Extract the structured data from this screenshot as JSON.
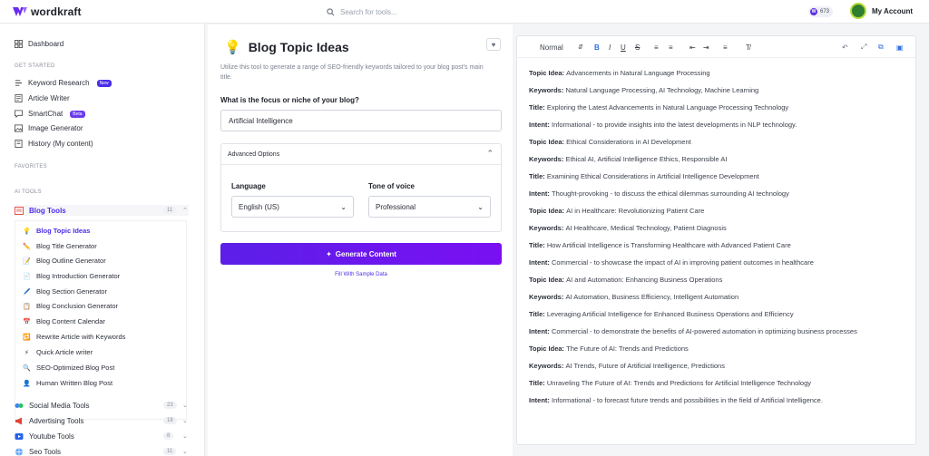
{
  "app": {
    "name": "wordkraft"
  },
  "topbar": {
    "search_placeholder": "Search for tools...",
    "credits": "673",
    "credits_icon_letter": "W",
    "account_label": "My Account"
  },
  "sidebar": {
    "dashboard": "Dashboard",
    "get_started_label": "GET STARTED",
    "get_started": [
      {
        "label": "Keyword Research",
        "badge": "New",
        "icon": "key-icon"
      },
      {
        "label": "Article Writer",
        "icon": "article-icon"
      },
      {
        "label": "SmartChat",
        "badge": "Beta",
        "icon": "chat-icon"
      },
      {
        "label": "Image Generator",
        "icon": "image-icon"
      },
      {
        "label": "History (My content)",
        "icon": "history-icon"
      }
    ],
    "favorites_label": "FAVORITES",
    "ai_tools_label": "AI TOOLS",
    "groups": [
      {
        "label": "Blog Tools",
        "count": "11",
        "chevron": "^"
      },
      {
        "label": "Social Media Tools",
        "count": "23",
        "chevron": "v"
      },
      {
        "label": "Advertising Tools",
        "count": "18",
        "chevron": "v"
      },
      {
        "label": "Youtube Tools",
        "count": "8",
        "chevron": "v"
      },
      {
        "label": "Seo Tools",
        "count": "11",
        "chevron": "v"
      }
    ],
    "blog_tools": [
      {
        "label": "Blog Topic Ideas",
        "icon": "💡"
      },
      {
        "label": "Blog Title Generator",
        "icon": "✏️"
      },
      {
        "label": "Blog Outline Generator",
        "icon": "📝"
      },
      {
        "label": "Blog Introduction Generator",
        "icon": "📄"
      },
      {
        "label": "Blog Section Generator",
        "icon": "🖊️"
      },
      {
        "label": "Blog Conclusion Generator",
        "icon": "📋"
      },
      {
        "label": "Blog Content Calendar",
        "icon": "📅"
      },
      {
        "label": "Rewrite Article with Keywords",
        "icon": "🔁"
      },
      {
        "label": "Quick Article writer",
        "icon": "⚡"
      },
      {
        "label": "SEO-Optimized Blog Post",
        "icon": "🔍"
      },
      {
        "label": "Human Written Blog Post",
        "icon": "👤"
      }
    ]
  },
  "form": {
    "title": "Blog Topic Ideas",
    "description": "Utilize this tool to generate a range of SEO-friendly keywords tailored to your blog post's main title.",
    "focus_label": "What is the focus or niche of your blog?",
    "focus_value": "Artificial Intelligence",
    "advanced_label": "Advanced Options",
    "language_label": "Language",
    "language_value": "English (US)",
    "tone_label": "Tone of voice",
    "tone_value": "Professional",
    "generate_label": "Generate Content",
    "sample_label": "Fill With Sample Data"
  },
  "editor": {
    "style_select": "Normal",
    "output": [
      {
        "k": "Topic Idea",
        "v": "Advancements in Natural Language Processing"
      },
      {
        "k": "Keywords",
        "v": "Natural Language Processing, AI Technology, Machine Learning"
      },
      {
        "k": "Title",
        "v": "Exploring the Latest Advancements in Natural Language Processing Technology"
      },
      {
        "k": "Intent",
        "v": "Informational - to provide insights into the latest developments in NLP technology."
      },
      {
        "k": "Topic Idea",
        "v": "Ethical Considerations in AI Development"
      },
      {
        "k": "Keywords",
        "v": "Ethical AI, Artificial Intelligence Ethics, Responsible AI"
      },
      {
        "k": "Title",
        "v": "Examining Ethical Considerations in Artificial Intelligence Development"
      },
      {
        "k": "Intent",
        "v": "Thought-provoking - to discuss the ethical dilemmas surrounding AI technology"
      },
      {
        "k": "Topic Idea",
        "v": "AI in Healthcare: Revolutionizing Patient Care"
      },
      {
        "k": "Keywords",
        "v": "AI Healthcare, Medical Technology, Patient Diagnosis"
      },
      {
        "k": "Title",
        "v": "How Artificial Intelligence is Transforming Healthcare with Advanced Patient Care"
      },
      {
        "k": "Intent",
        "v": "Commercial - to showcase the impact of AI in improving patient outcomes in healthcare"
      },
      {
        "k": "Topic Idea",
        "v": "AI and Automation: Enhancing Business Operations"
      },
      {
        "k": "Keywords",
        "v": "AI Automation, Business Efficiency, Intelligent Automation"
      },
      {
        "k": "Title",
        "v": "Leveraging Artificial Intelligence for Enhanced Business Operations and Efficiency"
      },
      {
        "k": "Intent",
        "v": "Commercial - to demonstrate the benefits of AI-powered automation in optimizing business processes"
      },
      {
        "k": "Topic Idea",
        "v": "The Future of AI: Trends and Predictions"
      },
      {
        "k": "Keywords",
        "v": "AI Trends, Future of Artificial Intelligence, Predictions"
      },
      {
        "k": "Title",
        "v": "Unraveling The Future of AI: Trends and Predictions for Artificial Intelligence Technology"
      },
      {
        "k": "Intent",
        "v": "Informational - to forecast future trends and possibilities in the field of Artificial Intelligence."
      }
    ]
  },
  "colors": {
    "accent": "#4b2ee8",
    "button_start": "#5b1fe8",
    "button_end": "#7a10f2"
  }
}
